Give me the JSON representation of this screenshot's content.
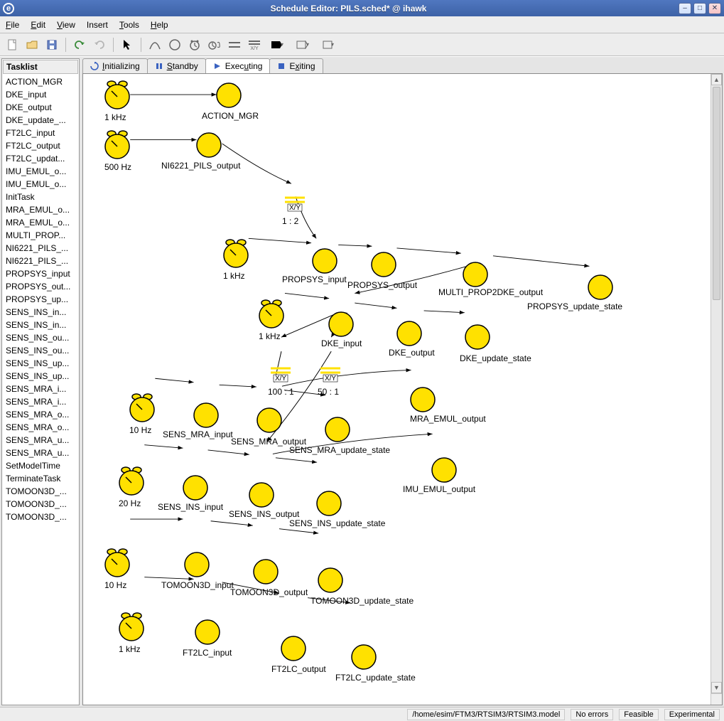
{
  "window": {
    "app_badge": "e",
    "title": "Schedule Editor: PILS.sched* @ ihawk"
  },
  "menu": {
    "file": "File",
    "edit": "Edit",
    "view": "View",
    "insert": "Insert",
    "tools": "Tools",
    "help": "Help"
  },
  "tasklist": {
    "header": "Tasklist",
    "items": [
      "ACTION_MGR",
      "DKE_input",
      "DKE_output",
      "DKE_update_...",
      "FT2LC_input",
      "FT2LC_output",
      "FT2LC_updat...",
      "IMU_EMUL_o...",
      "IMU_EMUL_o...",
      "InitTask",
      "MRA_EMUL_o...",
      "MRA_EMUL_o...",
      "MULTI_PROP...",
      "NI6221_PILS_...",
      "NI6221_PILS_...",
      "PROPSYS_input",
      "PROPSYS_out...",
      "PROPSYS_up...",
      "SENS_INS_in...",
      "SENS_INS_in...",
      "SENS_INS_ou...",
      "SENS_INS_ou...",
      "SENS_INS_up...",
      "SENS_INS_up...",
      "SENS_MRA_i...",
      "SENS_MRA_i...",
      "SENS_MRA_o...",
      "SENS_MRA_o...",
      "SENS_MRA_u...",
      "SENS_MRA_u...",
      "SetModelTime",
      "TerminateTask",
      "TOMOON3D_...",
      "TOMOON3D_...",
      "TOMOON3D_..."
    ]
  },
  "tabs": {
    "initializing": "Initializing",
    "standby": "Standby",
    "executing": "Executing",
    "exiting": "Exiting"
  },
  "dividers": {
    "xy_label": "X/Y",
    "d1_ratio": "1 : 2",
    "d2_ratio": "100 : 1",
    "d3_ratio": "50 : 1"
  },
  "clock_labels": {
    "c1": "1 kHz",
    "c2": "500 Hz",
    "c3": "1 kHz",
    "c4": "1 kHz",
    "c5": "10 Hz",
    "c6": "20 Hz",
    "c7": "10 Hz",
    "c8": "1 kHz"
  },
  "node_labels": {
    "n1": "ACTION_MGR",
    "n2": "NI6221_PILS_output",
    "n3": "PROPSYS_input",
    "n4": "PROPSYS_output",
    "n5": "MULTI_PROP2DKE_output",
    "n6": "PROPSYS_update_state",
    "n7": "DKE_input",
    "n8": "DKE_output",
    "n9": "DKE_update_state",
    "n10": "SENS_MRA_input",
    "n11": "SENS_MRA_output",
    "n12": "SENS_MRA_update_state",
    "n13": "MRA_EMUL_output",
    "n14": "SENS_INS_input",
    "n15": "SENS_INS_output",
    "n16": "SENS_INS_update_state",
    "n17": "IMU_EMUL_output",
    "n18": "TOMOON3D_input",
    "n19": "TOMOON3D_output",
    "n20": "TOMOON3D_update_state",
    "n21": "FT2LC_input",
    "n22": "FT2LC_output",
    "n23": "FT2LC_update_state"
  },
  "status": {
    "path": "/home/esim/FTM3/RTSIM3/RTSIM3.model",
    "errors": "No errors",
    "feasible": "Feasible",
    "mode": "Experimental"
  }
}
